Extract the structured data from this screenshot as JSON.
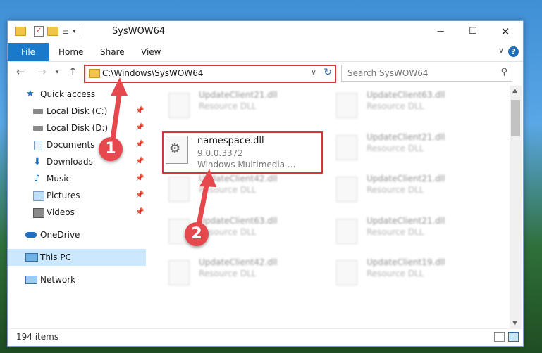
{
  "window": {
    "title": "SysWOW64",
    "controls": {
      "minimize": "─",
      "maximize": "☐",
      "close": "✕"
    }
  },
  "ribbon": {
    "tabs": [
      "File",
      "Home",
      "Share",
      "View"
    ],
    "help": "?"
  },
  "address": {
    "path": "C:\\Windows\\SysWOW64",
    "search_placeholder": "Search SysWOW64"
  },
  "nav": {
    "items": [
      {
        "label": "Quick access",
        "icon": "star-icon",
        "pinned": false
      },
      {
        "label": "Local Disk (C:)",
        "icon": "drive-icon",
        "pinned": true
      },
      {
        "label": "Local Disk (D:)",
        "icon": "drive-icon",
        "pinned": true
      },
      {
        "label": "Documents",
        "icon": "documents-icon",
        "pinned": true
      },
      {
        "label": "Downloads",
        "icon": "download-icon",
        "pinned": true
      },
      {
        "label": "Music",
        "icon": "music-icon",
        "pinned": true
      },
      {
        "label": "Pictures",
        "icon": "pictures-icon",
        "pinned": true
      },
      {
        "label": "Videos",
        "icon": "videos-icon",
        "pinned": true
      },
      {
        "label": "OneDrive",
        "icon": "onedrive-icon",
        "pinned": false
      },
      {
        "label": "This PC",
        "icon": "pc-icon",
        "pinned": false,
        "selected": true
      },
      {
        "label": "Network",
        "icon": "network-icon",
        "pinned": false
      }
    ]
  },
  "files": [
    {
      "name": "UpdateClient21.dll",
      "type": "Resource DLL"
    },
    {
      "name": "UpdateClient63.dll",
      "type": "Resource DLL"
    },
    {
      "name": "UpdateClient21.dll",
      "type": "Resource DLL"
    },
    {
      "name": "UpdateClient42.dll",
      "type": "Resource DLL"
    },
    {
      "name": "UpdateClient21.dll",
      "type": "Resource DLL"
    },
    {
      "name": "UpdateClient63.dll",
      "type": "Resource DLL"
    },
    {
      "name": "UpdateClient21.dll",
      "type": "Resource DLL"
    },
    {
      "name": "UpdateClient42.dll",
      "type": "Resource DLL"
    },
    {
      "name": "UpdateClient19.dll",
      "type": "Resource DLL"
    }
  ],
  "highlighted_file": {
    "name": "namespace.dll",
    "version": "9.0.0.3372",
    "description": "Windows Multimedia ..."
  },
  "status": {
    "item_count": "194 items"
  },
  "annotations": {
    "step1": "1",
    "step2": "2"
  },
  "colors": {
    "accent": "#1979ca",
    "highlight_red": "#d9343a",
    "badge": "#e5484d"
  }
}
